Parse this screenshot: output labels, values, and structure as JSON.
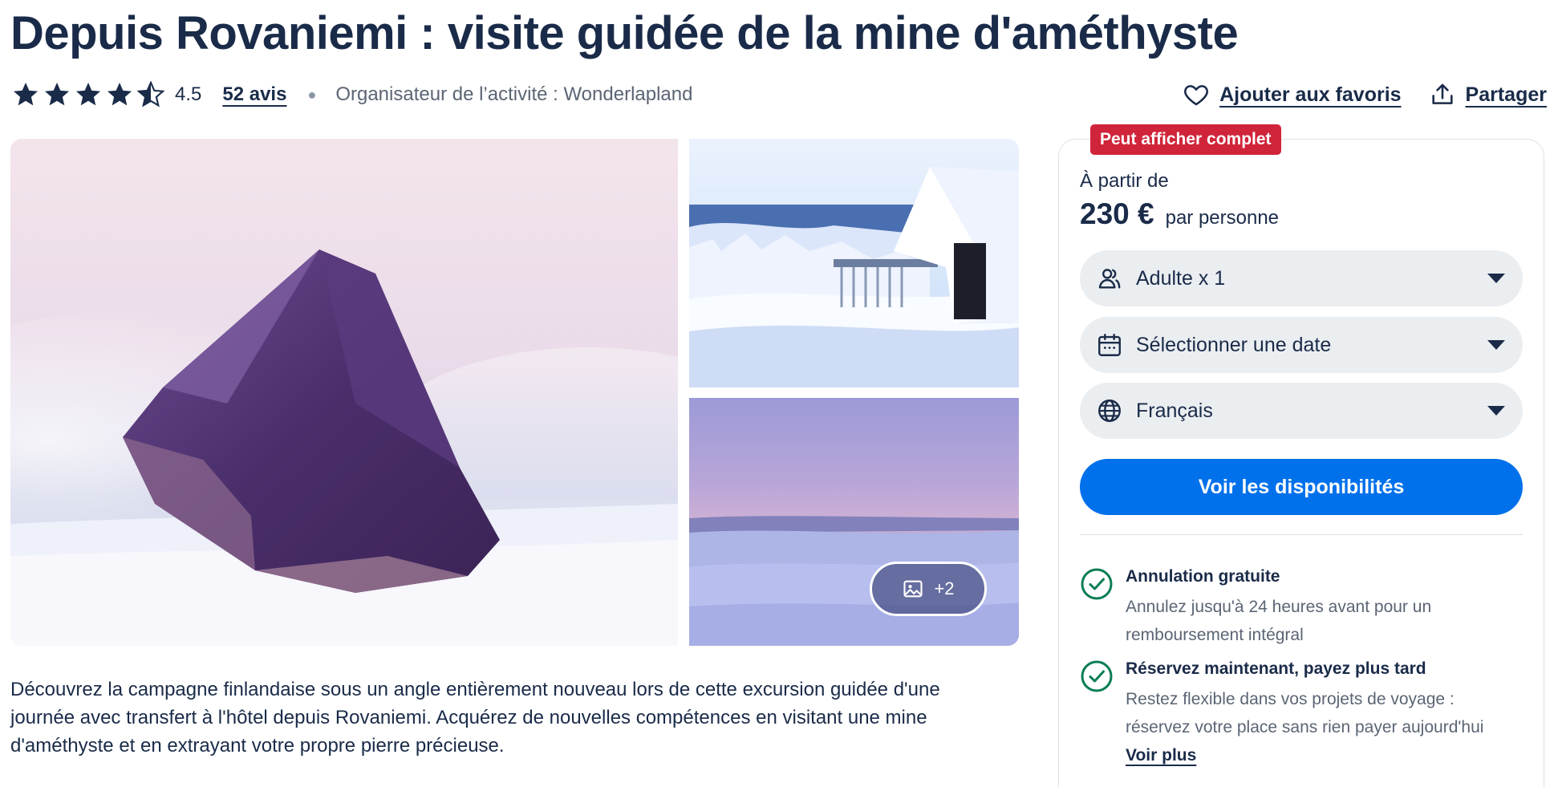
{
  "product": {
    "title": "Depuis Rovaniemi : visite guidée de la mine d'améthyste",
    "rating": "4.5",
    "reviews_label": "52 avis",
    "organizer": "Organisateur de l’activité : Wonderlapland",
    "description": "Découvrez la campagne finlandaise sous un angle entièrement nouveau lors de cette excursion guidée d'une journée avec transfert à l'hôtel depuis Rovaniemi. Acquérez de nouvelles compétences en visitant une mine d'améthyste et en extrayant votre propre pierre précieuse."
  },
  "actions": {
    "favorite_label": "Ajouter aux favoris",
    "share_label": "Partager"
  },
  "gallery": {
    "more_label": "+2",
    "images": [
      "amethyst-crystal-in-snow",
      "snow-covered-cabin",
      "foggy-winter-landscape"
    ]
  },
  "booking": {
    "badge": "Peut afficher complet",
    "from_label": "À partir de",
    "price": "230 €",
    "per_label": "par personne",
    "participants": "Adulte x 1",
    "date_placeholder": "Sélectionner une date",
    "language": "Français",
    "cta_label": "Voir les disponibilités",
    "perks": [
      {
        "title": "Annulation gratuite",
        "desc": "Annulez jusqu'à 24 heures avant pour un remboursement intégral"
      },
      {
        "title": "Réservez maintenant, payez plus tard",
        "desc": "Restez flexible dans vos projets de voyage : réservez votre place sans rien payer aujourd'hui"
      }
    ],
    "see_more_label": "Voir plus"
  },
  "colors": {
    "text": "#1a2b49",
    "muted": "#5b6574",
    "cta": "#0071eb",
    "badge": "#d0243a",
    "check": "#0a7d52",
    "select_bg": "#ebeef1"
  }
}
